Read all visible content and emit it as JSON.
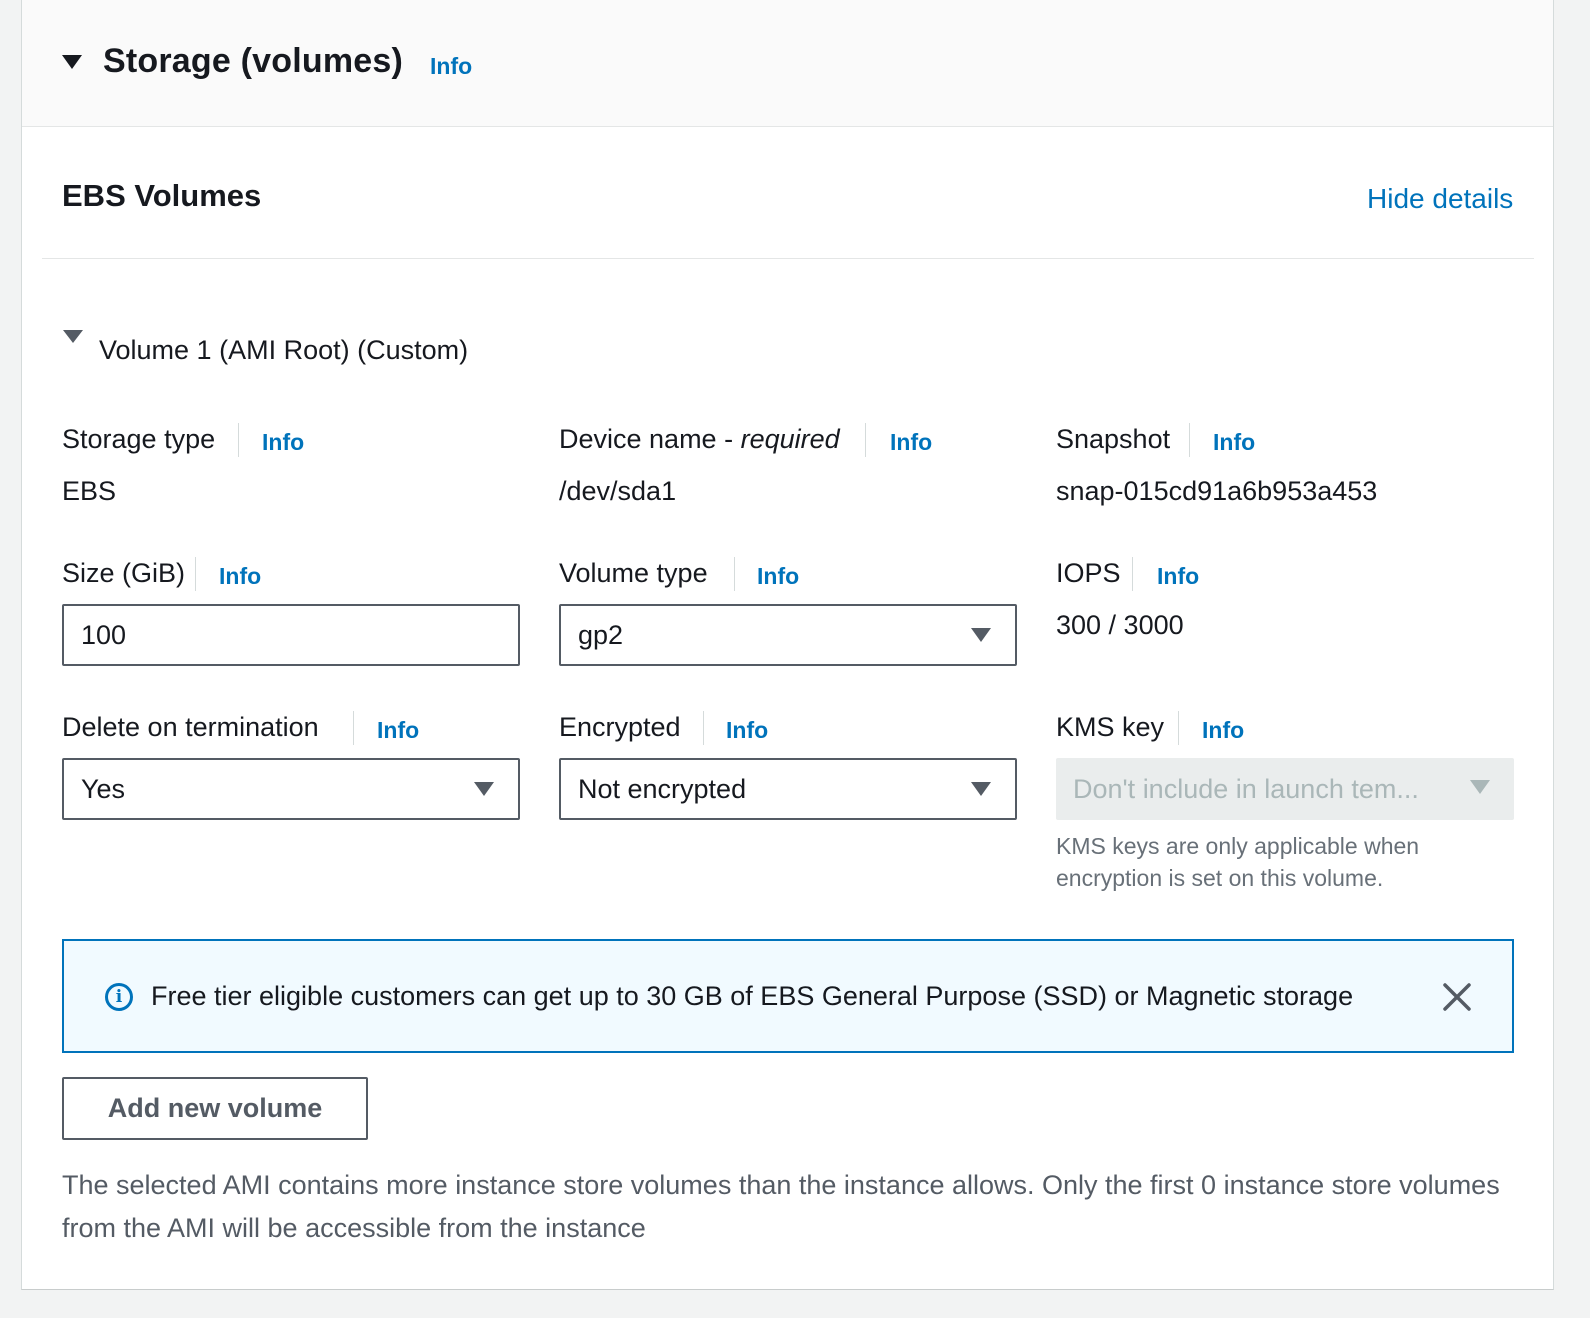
{
  "section": {
    "title": "Storage (volumes)",
    "info": "Info"
  },
  "ebs": {
    "title": "EBS Volumes",
    "hide_details": "Hide details"
  },
  "volume": {
    "title": "Volume 1 (AMI Root) (Custom)"
  },
  "fields": {
    "storage_type": {
      "label": "Storage type",
      "info": "Info",
      "value": "EBS"
    },
    "device_name": {
      "label": "Device name - ",
      "label_italic": "required",
      "info": "Info",
      "value": "/dev/sda1"
    },
    "snapshot": {
      "label": "Snapshot",
      "info": "Info",
      "value": "snap-015cd91a6b953a453"
    },
    "size": {
      "label": "Size (GiB)",
      "info": "Info",
      "value": "100"
    },
    "volume_type": {
      "label": "Volume type",
      "info": "Info",
      "value": "gp2"
    },
    "iops": {
      "label": "IOPS",
      "info": "Info",
      "value": "300 / 3000"
    },
    "delete_on_termination": {
      "label": "Delete on termination",
      "info": "Info",
      "value": "Yes"
    },
    "encrypted": {
      "label": "Encrypted",
      "info": "Info",
      "value": "Not encrypted"
    },
    "kms_key": {
      "label": "KMS key",
      "info": "Info",
      "value": "Don't include in launch tem...",
      "hint": "KMS keys are only applicable when encryption is set on this volume."
    }
  },
  "alert": {
    "text": "Free tier eligible customers can get up to 30 GB of EBS General Purpose (SSD) or Magnetic storage",
    "icon": "info-circle-icon"
  },
  "add_volume_button": "Add new volume",
  "footnote": "The selected AMI contains more instance store volumes than the instance allows. Only the first 0 instance store volumes from the AMI will be accessible from the instance",
  "colors": {
    "link": "#0073bb",
    "alert_bg": "#f1faff",
    "alert_border": "#0073bb",
    "text": "#16191f"
  }
}
